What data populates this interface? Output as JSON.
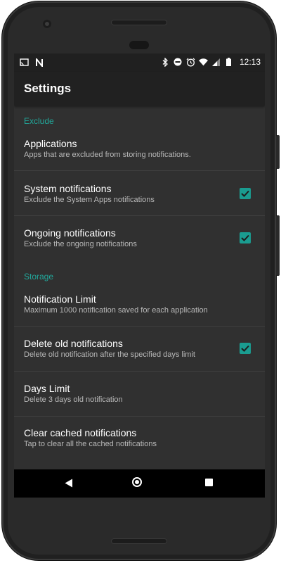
{
  "status_bar": {
    "time": "12:13",
    "left_icons": [
      "cast-icon",
      "n-icon"
    ],
    "right_icons": [
      "bluetooth-icon",
      "do-not-disturb-icon",
      "alarm-icon",
      "wifi-icon",
      "signal-icon",
      "battery-icon"
    ]
  },
  "app_bar": {
    "title": "Settings"
  },
  "categories": {
    "exclude": "Exclude",
    "storage": "Storage"
  },
  "prefs": {
    "applications": {
      "title": "Applications",
      "summary": "Apps that are excluded from storing notifications."
    },
    "system": {
      "title": "System notifications",
      "summary": "Exclude the System Apps notifications",
      "checked": true
    },
    "ongoing": {
      "title": "Ongoing notifications",
      "summary": "Exclude the ongoing notifications",
      "checked": true
    },
    "limit": {
      "title": "Notification Limit",
      "summary": "Maximum 1000 notification saved for each application"
    },
    "delete_old": {
      "title": "Delete old notifications",
      "summary": "Delete old notification after the specified days limit",
      "checked": true
    },
    "days_limit": {
      "title": "Days Limit",
      "summary": "Delete 3 days old notification"
    },
    "clear_cache": {
      "title": "Clear cached notifications",
      "summary": "Tap to clear all the cached notifications"
    }
  },
  "colors": {
    "accent": "#1a9c90",
    "category_text": "#22a79a",
    "background": "#303030",
    "app_bar": "#212121"
  },
  "nav_bar": [
    "back-icon",
    "home-icon",
    "recents-icon"
  ]
}
